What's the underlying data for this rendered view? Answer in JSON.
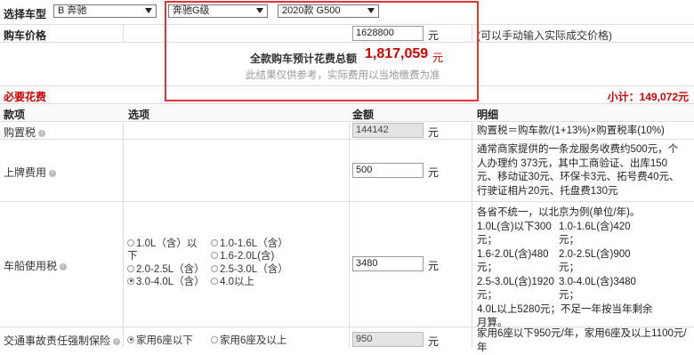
{
  "selector": {
    "label": "选择车型",
    "brand": "B 奔驰",
    "series": "奔驰G级",
    "model": "2020款 G500"
  },
  "price": {
    "label": "购车价格",
    "value": "1628800",
    "unit": "元",
    "hint": "(可以手动输入实际成交价格)"
  },
  "summary": {
    "title": "全款购车预计花费总额",
    "total": "1,817,059",
    "unit": "元",
    "note": "此结果仅供参考，实际费用以当地缴费为准"
  },
  "section": {
    "title": "必要花费",
    "subtotal_label": "小计：",
    "subtotal": "149,072元"
  },
  "table": {
    "headers": [
      "款项",
      "选项",
      "金额",
      "明细"
    ],
    "rows": {
      "purchase_tax": {
        "name": "购置税",
        "amount": "144142",
        "unit": "元",
        "detail": "购置税＝购车款/(1+13%)×购置税率(10%)"
      },
      "registration": {
        "name": "上牌费用",
        "amount": "500",
        "unit": "元",
        "detail": [
          "通常商家提供的一条龙服务收费约500元，个",
          "人办理约 373元，其中工商验证、出库150",
          "元、移动证30元、环保卡3元、拓号费40元、",
          "行驶证相片20元、托盘费130元"
        ]
      },
      "vehicle_tax": {
        "name": "车船使用税",
        "amount": "3480",
        "unit": "元",
        "options": [
          {
            "label": "1.0L（含）以",
            "label2": "下",
            "checked": false
          },
          {
            "label": "1.0-1.6L（含）",
            "checked": false
          },
          {
            "label": "1.6-2.0L(含)",
            "checked": false
          },
          {
            "label": "2.0-2.5L（含）",
            "checked": false
          },
          {
            "label": "2.5-3.0L（含）",
            "checked": false
          },
          {
            "label": "3.0-4.0L（含）",
            "checked": true
          },
          {
            "label": "4.0以上",
            "checked": false
          }
        ],
        "detail_intro": "各省不统一，以北京为例(单位/年)。",
        "detail_grid": [
          [
            "1.0L(含)以下300",
            "1.0-1.6L(含)420"
          ],
          [
            "元；",
            "元；"
          ],
          [
            "1.6-2.0L(含)480",
            "2.0-2.5L(含)900"
          ],
          [
            "元；",
            "元；"
          ],
          [
            "2.5-3.0L(含)1920",
            "3.0-4.0L(含)3480"
          ],
          [
            "元；",
            "元；"
          ]
        ],
        "detail_tail": [
          "4.0L以上5280元；不足一年按当年剩余",
          "月算。"
        ]
      },
      "compulsory": {
        "name": "交通事故责任强制保险",
        "amount": "950",
        "unit": "元",
        "options": [
          {
            "label": "家用6座以下",
            "checked": true
          },
          {
            "label": "家用6座及以上",
            "checked": false
          }
        ],
        "detail": "家用6座以下950元/年，家用6座及以上1100元/年"
      }
    }
  },
  "colors": {
    "highlight": "#e3343a",
    "accent_red": "#cc0000",
    "readonly_bg": "#e4e4e4"
  }
}
